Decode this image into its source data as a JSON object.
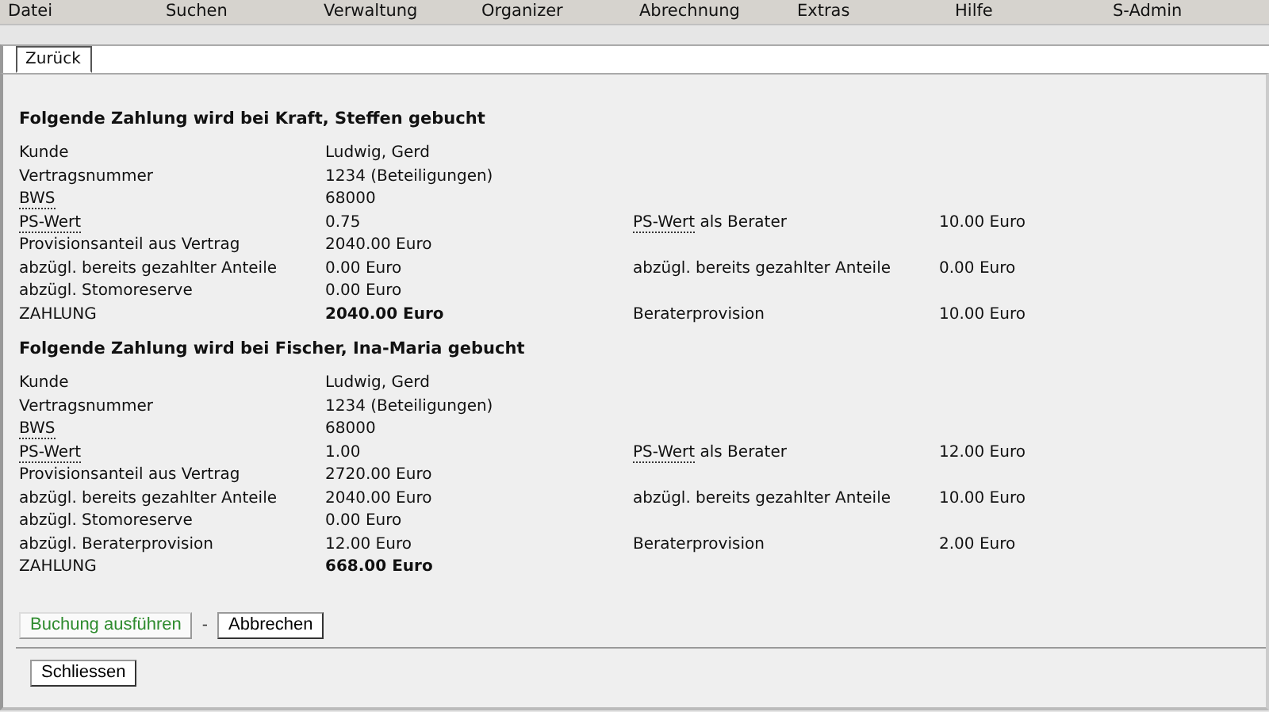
{
  "menu": [
    "Datei",
    "Suchen",
    "Verwaltung",
    "Organizer",
    "Abrechnung",
    "Extras",
    "Hilfe",
    "S-Admin"
  ],
  "tabs": [
    {
      "label": "Zurück",
      "selected": true
    }
  ],
  "sections": [
    {
      "title": "Folgende Zahlung wird bei Kraft, Steffen gebucht",
      "rows": [
        {
          "label": "Kunde",
          "value": "Ludwig, Gerd"
        },
        {
          "label": "Vertragsnummer",
          "value": "1234 (Beteiligungen)"
        },
        {
          "abbr": "BWS",
          "value": "68000"
        },
        {
          "abbr": "PS-Wert",
          "value": "0.75",
          "right": {
            "abbr": "PS-Wert",
            "label": "als Berater",
            "value": "10.00 Euro"
          }
        },
        {
          "label": "Provisionsanteil aus Vertrag",
          "value": "2040.00 Euro"
        },
        {
          "label": "abzügl. bereits gezahlter Anteile",
          "value": "0.00 Euro",
          "right": {
            "label": "abzügl. bereits gezahlter Anteile",
            "value": "0.00 Euro"
          }
        },
        {
          "label": "abzügl. Stomoreserve",
          "value": "0.00 Euro"
        },
        {
          "label": "ZAHLUNG",
          "value": "2040.00 Euro",
          "bold": true,
          "right": {
            "label": "Beraterprovision",
            "value": "10.00 Euro"
          }
        }
      ]
    },
    {
      "title": "Folgende Zahlung wird bei Fischer, Ina-Maria gebucht",
      "rows": [
        {
          "label": "Kunde",
          "value": "Ludwig, Gerd"
        },
        {
          "label": "Vertragsnummer",
          "value": "1234 (Beteiligungen)"
        },
        {
          "abbr": "BWS",
          "value": "68000"
        },
        {
          "abbr": "PS-Wert",
          "value": "1.00",
          "right": {
            "abbr": "PS-Wert",
            "label": "als Berater",
            "value": "12.00 Euro"
          }
        },
        {
          "label": "Provisionsanteil aus Vertrag",
          "value": "2720.00 Euro"
        },
        {
          "label": "abzügl. bereits gezahlter Anteile",
          "value": "2040.00 Euro",
          "right": {
            "label": "abzügl. bereits gezahlter Anteile",
            "value": "10.00 Euro"
          }
        },
        {
          "label": "abzügl. Stomoreserve",
          "value": "0.00 Euro"
        },
        {
          "label": "abzügl. Beraterprovision",
          "value": "12.00 Euro",
          "right": {
            "label": "Beraterprovision",
            "value": "2.00 Euro"
          }
        },
        {
          "label": "ZAHLUNG",
          "value": "668.00 Euro",
          "bold": true
        }
      ]
    }
  ],
  "actions": {
    "confirm": "Buchung ausführen",
    "separator": "-",
    "cancel": "Abbrechen"
  },
  "close": "Schliessen"
}
